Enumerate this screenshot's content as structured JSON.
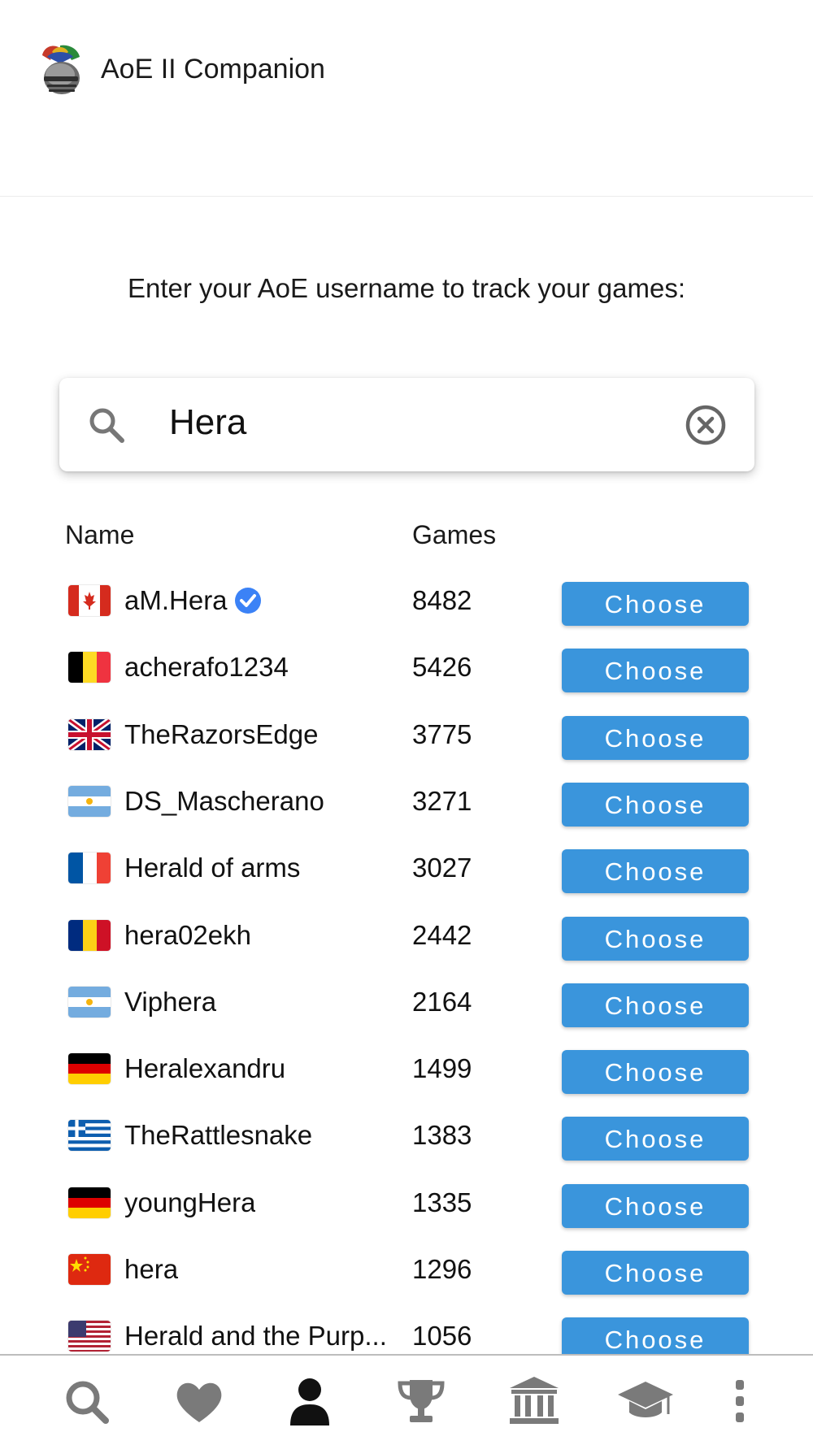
{
  "app": {
    "title": "AoE II Companion"
  },
  "prompt": "Enter your AoE username to track your games:",
  "search": {
    "value": "Hera"
  },
  "table": {
    "headers": {
      "name": "Name",
      "games": "Games"
    },
    "rows": [
      {
        "flag": "canada-flag",
        "name": "aM.Hera",
        "verified": true,
        "games": "8482",
        "action": "Choose"
      },
      {
        "flag": "belgium-flag",
        "name": "acherafo1234",
        "verified": false,
        "games": "5426",
        "action": "Choose"
      },
      {
        "flag": "united-kingdom-flag",
        "name": "TheRazorsEdge",
        "verified": false,
        "games": "3775",
        "action": "Choose"
      },
      {
        "flag": "argentina-flag",
        "name": "DS_Mascherano",
        "verified": false,
        "games": "3271",
        "action": "Choose"
      },
      {
        "flag": "france-flag",
        "name": "Herald of arms",
        "verified": false,
        "games": "3027",
        "action": "Choose"
      },
      {
        "flag": "romania-flag",
        "name": "hera02ekh",
        "verified": false,
        "games": "2442",
        "action": "Choose"
      },
      {
        "flag": "argentina-flag",
        "name": "Viphera",
        "verified": false,
        "games": "2164",
        "action": "Choose"
      },
      {
        "flag": "germany-flag",
        "name": "Heralexandru",
        "verified": false,
        "games": "1499",
        "action": "Choose"
      },
      {
        "flag": "greece-flag",
        "name": "TheRattlesnake",
        "verified": false,
        "games": "1383",
        "action": "Choose"
      },
      {
        "flag": "germany-flag",
        "name": "youngHera",
        "verified": false,
        "games": "1335",
        "action": "Choose"
      },
      {
        "flag": "china-flag",
        "name": "hera",
        "verified": false,
        "games": "1296",
        "action": "Choose"
      },
      {
        "flag": "usa-flag",
        "name": "Herald and the Purp...",
        "verified": false,
        "games": "1056",
        "action": "Choose"
      }
    ]
  },
  "nav": [
    {
      "icon": "search-icon",
      "active": false
    },
    {
      "icon": "heart-icon",
      "active": false
    },
    {
      "icon": "user-icon",
      "active": true
    },
    {
      "icon": "trophy-icon",
      "active": false
    },
    {
      "icon": "museum-icon",
      "active": false
    },
    {
      "icon": "graduation-cap-icon",
      "active": false
    },
    {
      "icon": "more-vertical-icon",
      "active": false
    }
  ],
  "colors": {
    "accent": "#3a95dc",
    "nav_inactive": "#7a7a7a",
    "nav_active": "#111111",
    "verified": "#3b82f6"
  }
}
